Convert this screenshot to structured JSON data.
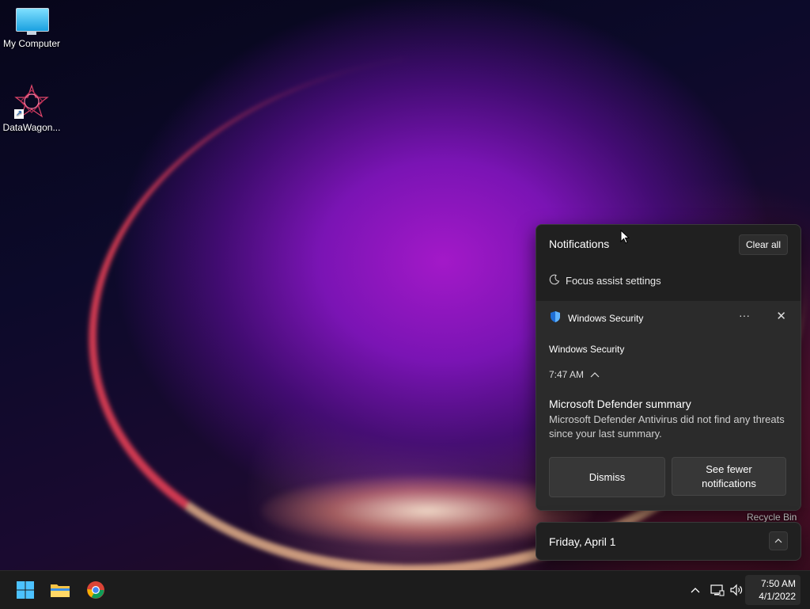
{
  "desktop": {
    "icons": [
      {
        "label": "My Computer",
        "icon": "monitor-icon"
      },
      {
        "label": "DataWagon...",
        "icon": "datawagon-app-icon"
      }
    ],
    "recycle_bin_label": "Recycle Bin"
  },
  "notification_center": {
    "title": "Notifications",
    "clear_all_label": "Clear all",
    "focus_assist_label": "Focus assist settings",
    "toast": {
      "source": "Windows Security",
      "app_name": "Windows Security",
      "time": "7:47 AM",
      "title": "Microsoft Defender summary",
      "body": "Microsoft Defender Antivirus did not find any threats since your last summary.",
      "more_glyph": "···",
      "close_glyph": "✕",
      "buttons": [
        "Dismiss",
        "See fewer notifications"
      ]
    }
  },
  "calendar_flyout": {
    "date_label": "Friday, April 1",
    "toggle_glyph": "^"
  },
  "taskbar": {
    "pinned": [
      "windows-start-icon",
      "file-explorer-icon",
      "chrome-icon"
    ],
    "tray": {
      "overflow_glyph": "^",
      "network_icon": "network-icon",
      "volume_icon": "volume-icon"
    },
    "clock": {
      "time": "7:50 AM",
      "date": "4/1/2022"
    }
  },
  "colors": {
    "panel_bg": "#202020",
    "toast_bg": "#2b2b2b",
    "taskbar_bg": "#1c1c1c",
    "accent_blue": "#0078d4"
  }
}
